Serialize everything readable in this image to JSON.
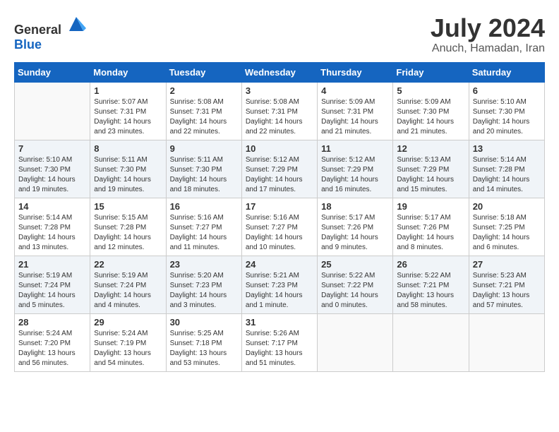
{
  "header": {
    "logo": {
      "general": "General",
      "blue": "Blue"
    },
    "title": "July 2024",
    "location": "Anuch, Hamadan, Iran"
  },
  "days_of_week": [
    "Sunday",
    "Monday",
    "Tuesday",
    "Wednesday",
    "Thursday",
    "Friday",
    "Saturday"
  ],
  "weeks": [
    [
      {
        "day": "",
        "sunrise": "",
        "sunset": "",
        "daylight": "",
        "empty": true
      },
      {
        "day": "1",
        "sunrise": "Sunrise: 5:07 AM",
        "sunset": "Sunset: 7:31 PM",
        "daylight": "Daylight: 14 hours and 23 minutes."
      },
      {
        "day": "2",
        "sunrise": "Sunrise: 5:08 AM",
        "sunset": "Sunset: 7:31 PM",
        "daylight": "Daylight: 14 hours and 22 minutes."
      },
      {
        "day": "3",
        "sunrise": "Sunrise: 5:08 AM",
        "sunset": "Sunset: 7:31 PM",
        "daylight": "Daylight: 14 hours and 22 minutes."
      },
      {
        "day": "4",
        "sunrise": "Sunrise: 5:09 AM",
        "sunset": "Sunset: 7:31 PM",
        "daylight": "Daylight: 14 hours and 21 minutes."
      },
      {
        "day": "5",
        "sunrise": "Sunrise: 5:09 AM",
        "sunset": "Sunset: 7:30 PM",
        "daylight": "Daylight: 14 hours and 21 minutes."
      },
      {
        "day": "6",
        "sunrise": "Sunrise: 5:10 AM",
        "sunset": "Sunset: 7:30 PM",
        "daylight": "Daylight: 14 hours and 20 minutes."
      }
    ],
    [
      {
        "day": "7",
        "sunrise": "Sunrise: 5:10 AM",
        "sunset": "Sunset: 7:30 PM",
        "daylight": "Daylight: 14 hours and 19 minutes."
      },
      {
        "day": "8",
        "sunrise": "Sunrise: 5:11 AM",
        "sunset": "Sunset: 7:30 PM",
        "daylight": "Daylight: 14 hours and 19 minutes."
      },
      {
        "day": "9",
        "sunrise": "Sunrise: 5:11 AM",
        "sunset": "Sunset: 7:30 PM",
        "daylight": "Daylight: 14 hours and 18 minutes."
      },
      {
        "day": "10",
        "sunrise": "Sunrise: 5:12 AM",
        "sunset": "Sunset: 7:29 PM",
        "daylight": "Daylight: 14 hours and 17 minutes."
      },
      {
        "day": "11",
        "sunrise": "Sunrise: 5:12 AM",
        "sunset": "Sunset: 7:29 PM",
        "daylight": "Daylight: 14 hours and 16 minutes."
      },
      {
        "day": "12",
        "sunrise": "Sunrise: 5:13 AM",
        "sunset": "Sunset: 7:29 PM",
        "daylight": "Daylight: 14 hours and 15 minutes."
      },
      {
        "day": "13",
        "sunrise": "Sunrise: 5:14 AM",
        "sunset": "Sunset: 7:28 PM",
        "daylight": "Daylight: 14 hours and 14 minutes."
      }
    ],
    [
      {
        "day": "14",
        "sunrise": "Sunrise: 5:14 AM",
        "sunset": "Sunset: 7:28 PM",
        "daylight": "Daylight: 14 hours and 13 minutes."
      },
      {
        "day": "15",
        "sunrise": "Sunrise: 5:15 AM",
        "sunset": "Sunset: 7:28 PM",
        "daylight": "Daylight: 14 hours and 12 minutes."
      },
      {
        "day": "16",
        "sunrise": "Sunrise: 5:16 AM",
        "sunset": "Sunset: 7:27 PM",
        "daylight": "Daylight: 14 hours and 11 minutes."
      },
      {
        "day": "17",
        "sunrise": "Sunrise: 5:16 AM",
        "sunset": "Sunset: 7:27 PM",
        "daylight": "Daylight: 14 hours and 10 minutes."
      },
      {
        "day": "18",
        "sunrise": "Sunrise: 5:17 AM",
        "sunset": "Sunset: 7:26 PM",
        "daylight": "Daylight: 14 hours and 9 minutes."
      },
      {
        "day": "19",
        "sunrise": "Sunrise: 5:17 AM",
        "sunset": "Sunset: 7:26 PM",
        "daylight": "Daylight: 14 hours and 8 minutes."
      },
      {
        "day": "20",
        "sunrise": "Sunrise: 5:18 AM",
        "sunset": "Sunset: 7:25 PM",
        "daylight": "Daylight: 14 hours and 6 minutes."
      }
    ],
    [
      {
        "day": "21",
        "sunrise": "Sunrise: 5:19 AM",
        "sunset": "Sunset: 7:24 PM",
        "daylight": "Daylight: 14 hours and 5 minutes."
      },
      {
        "day": "22",
        "sunrise": "Sunrise: 5:19 AM",
        "sunset": "Sunset: 7:24 PM",
        "daylight": "Daylight: 14 hours and 4 minutes."
      },
      {
        "day": "23",
        "sunrise": "Sunrise: 5:20 AM",
        "sunset": "Sunset: 7:23 PM",
        "daylight": "Daylight: 14 hours and 3 minutes."
      },
      {
        "day": "24",
        "sunrise": "Sunrise: 5:21 AM",
        "sunset": "Sunset: 7:23 PM",
        "daylight": "Daylight: 14 hours and 1 minute."
      },
      {
        "day": "25",
        "sunrise": "Sunrise: 5:22 AM",
        "sunset": "Sunset: 7:22 PM",
        "daylight": "Daylight: 14 hours and 0 minutes."
      },
      {
        "day": "26",
        "sunrise": "Sunrise: 5:22 AM",
        "sunset": "Sunset: 7:21 PM",
        "daylight": "Daylight: 13 hours and 58 minutes."
      },
      {
        "day": "27",
        "sunrise": "Sunrise: 5:23 AM",
        "sunset": "Sunset: 7:21 PM",
        "daylight": "Daylight: 13 hours and 57 minutes."
      }
    ],
    [
      {
        "day": "28",
        "sunrise": "Sunrise: 5:24 AM",
        "sunset": "Sunset: 7:20 PM",
        "daylight": "Daylight: 13 hours and 56 minutes."
      },
      {
        "day": "29",
        "sunrise": "Sunrise: 5:24 AM",
        "sunset": "Sunset: 7:19 PM",
        "daylight": "Daylight: 13 hours and 54 minutes."
      },
      {
        "day": "30",
        "sunrise": "Sunrise: 5:25 AM",
        "sunset": "Sunset: 7:18 PM",
        "daylight": "Daylight: 13 hours and 53 minutes."
      },
      {
        "day": "31",
        "sunrise": "Sunrise: 5:26 AM",
        "sunset": "Sunset: 7:17 PM",
        "daylight": "Daylight: 13 hours and 51 minutes."
      },
      {
        "day": "",
        "sunrise": "",
        "sunset": "",
        "daylight": "",
        "empty": true
      },
      {
        "day": "",
        "sunrise": "",
        "sunset": "",
        "daylight": "",
        "empty": true
      },
      {
        "day": "",
        "sunrise": "",
        "sunset": "",
        "daylight": "",
        "empty": true
      }
    ]
  ]
}
